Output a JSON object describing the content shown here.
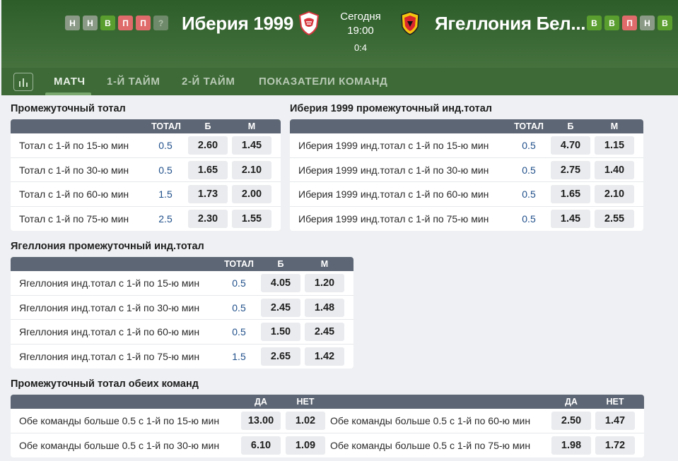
{
  "header": {
    "home_form": [
      "Н",
      "Н",
      "В",
      "П",
      "П",
      "?"
    ],
    "home_name": "Иберия 1999",
    "match_day": "Сегодня",
    "match_time": "19:00",
    "score": "0:4",
    "away_name": "Ягеллония Бел...",
    "away_form": [
      "В",
      "В",
      "П",
      "Н",
      "В"
    ],
    "colors": {
      "win": "#5a9e2f",
      "loss": "#e06b6b",
      "draw": "#8b9a87"
    }
  },
  "tabs": [
    {
      "label": "МАТЧ",
      "active": true
    },
    {
      "label": "1-Й ТАЙМ"
    },
    {
      "label": "2-Й ТАЙМ"
    },
    {
      "label": "ПОКАЗАТЕЛИ КОМАНД"
    }
  ],
  "tab_stats_icon": "bar-chart-icon",
  "markets": {
    "total": {
      "title": "Промежуточный тотал",
      "headers": [
        "ТОТАЛ",
        "Б",
        "М"
      ],
      "rows": [
        {
          "name": "Тотал с 1-й по 15-ю мин",
          "total": "0.5",
          "over": "2.60",
          "under": "1.45"
        },
        {
          "name": "Тотал с 1-й по 30-ю мин",
          "total": "0.5",
          "over": "1.65",
          "under": "2.10"
        },
        {
          "name": "Тотал с 1-й по 60-ю мин",
          "total": "1.5",
          "over": "1.73",
          "under": "2.00"
        },
        {
          "name": "Тотал с 1-й по 75-ю мин",
          "total": "2.5",
          "over": "2.30",
          "under": "1.55"
        }
      ]
    },
    "home_ind": {
      "title": "Иберия 1999 промежуточный инд.тотал",
      "headers": [
        "ТОТАЛ",
        "Б",
        "М"
      ],
      "rows": [
        {
          "name": "Иберия 1999 инд.тотал с 1-й по 15-ю мин",
          "total": "0.5",
          "over": "4.70",
          "under": "1.15"
        },
        {
          "name": "Иберия 1999 инд.тотал с 1-й по 30-ю мин",
          "total": "0.5",
          "over": "2.75",
          "under": "1.40"
        },
        {
          "name": "Иберия 1999 инд.тотал с 1-й по 60-ю мин",
          "total": "0.5",
          "over": "1.65",
          "under": "2.10"
        },
        {
          "name": "Иберия 1999 инд.тотал с 1-й по 75-ю мин",
          "total": "0.5",
          "over": "1.45",
          "under": "2.55"
        }
      ]
    },
    "away_ind": {
      "title": "Ягеллония промежуточный инд.тотал",
      "headers": [
        "ТОТАЛ",
        "Б",
        "М"
      ],
      "rows": [
        {
          "name": "Ягеллония инд.тотал с 1-й по 15-ю мин",
          "total": "0.5",
          "over": "4.05",
          "under": "1.20"
        },
        {
          "name": "Ягеллония инд.тотал с 1-й по 30-ю мин",
          "total": "0.5",
          "over": "2.45",
          "under": "1.48"
        },
        {
          "name": "Ягеллония инд.тотал с 1-й по 60-ю мин",
          "total": "0.5",
          "over": "1.50",
          "under": "2.45"
        },
        {
          "name": "Ягеллония инд.тотал с 1-й по 75-ю мин",
          "total": "1.5",
          "over": "2.65",
          "under": "1.42"
        }
      ]
    },
    "both": {
      "title": "Промежуточный тотал обеих команд",
      "headers": [
        "ДА",
        "НЕТ"
      ],
      "rows": [
        {
          "name": "Обе команды больше 0.5 с 1-й по 15-ю мин",
          "yes": "13.00",
          "no": "1.02",
          "name2": "Обе команды больше 0.5 с 1-й по 60-ю мин",
          "yes2": "2.50",
          "no2": "1.47"
        },
        {
          "name": "Обе команды больше 0.5 с 1-й по 30-ю мин",
          "yes": "6.10",
          "no": "1.09",
          "name2": "Обе команды больше 0.5 с 1-й по 75-ю мин",
          "yes2": "1.98",
          "no2": "1.72"
        }
      ]
    }
  }
}
